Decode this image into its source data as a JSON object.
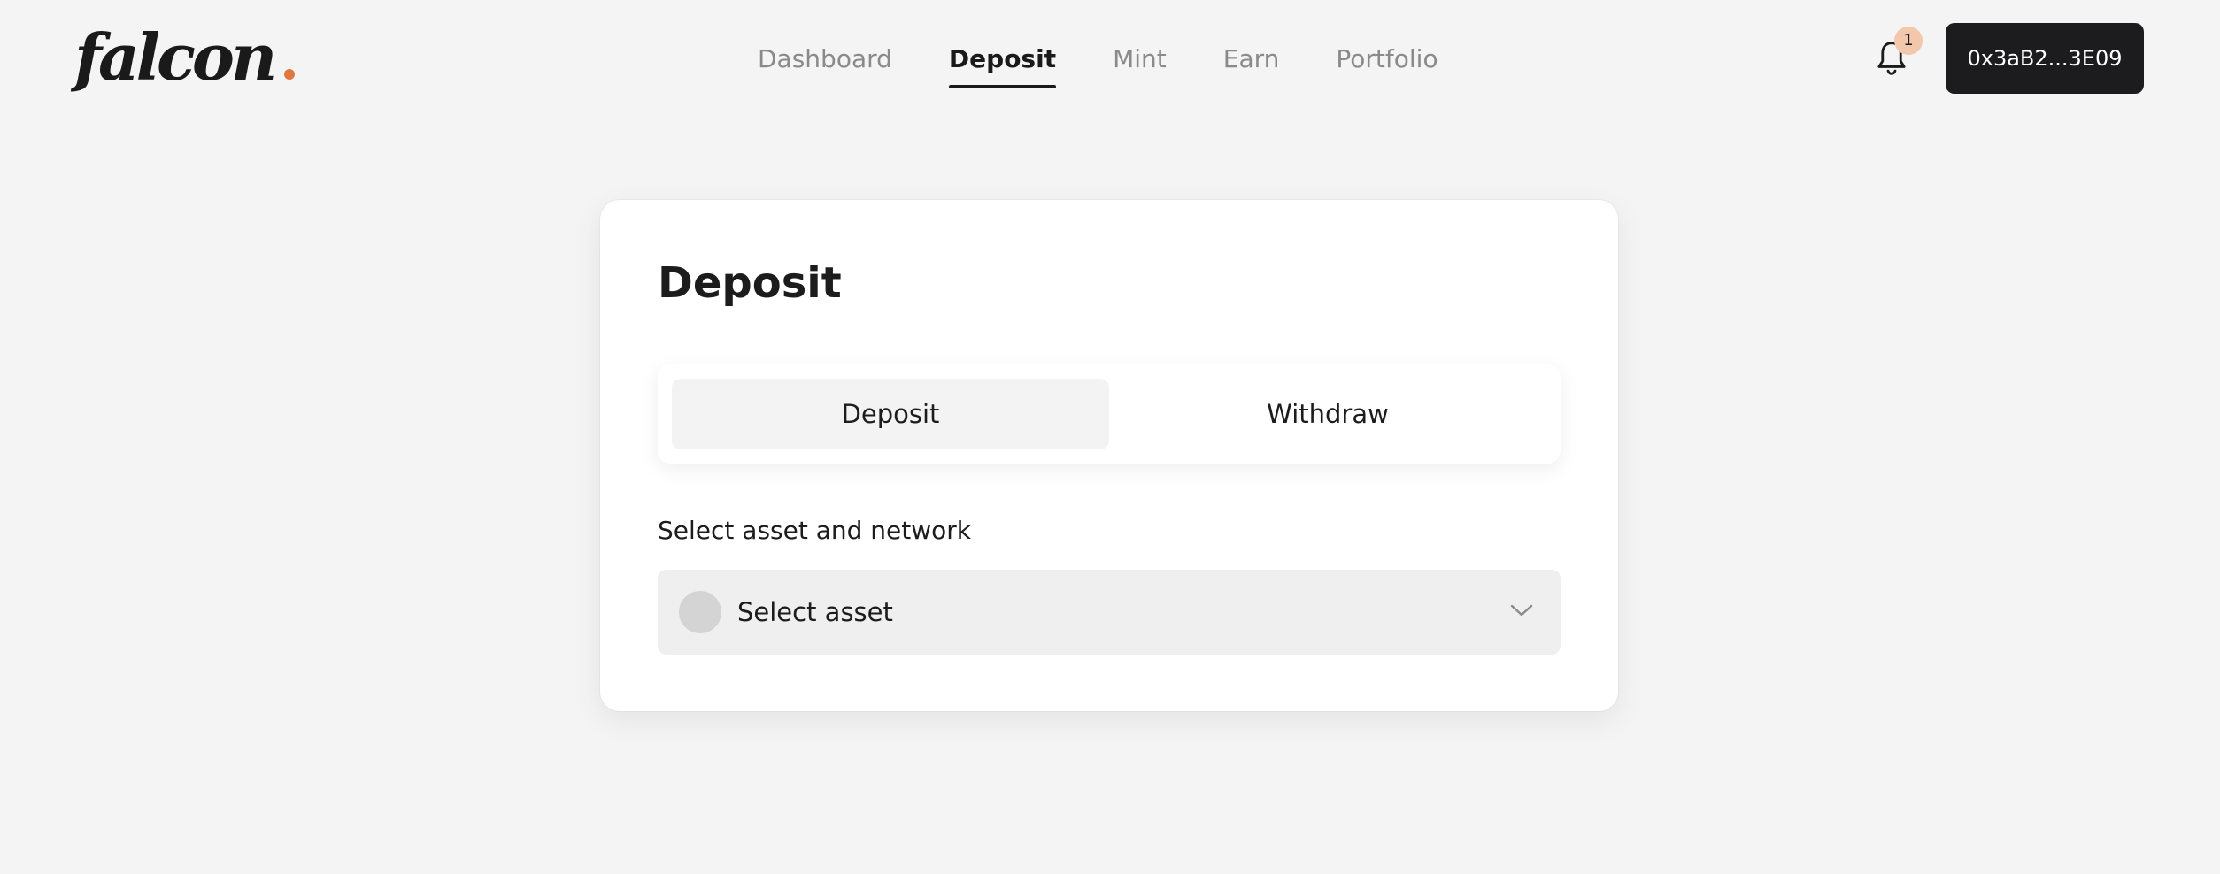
{
  "brand": {
    "logo_text": "falcon",
    "accent_color": "#e0773f"
  },
  "nav": {
    "items": [
      {
        "label": "Dashboard",
        "active": false
      },
      {
        "label": "Deposit",
        "active": true
      },
      {
        "label": "Mint",
        "active": false
      },
      {
        "label": "Earn",
        "active": false
      },
      {
        "label": "Portfolio",
        "active": false
      }
    ]
  },
  "notifications": {
    "icon": "bell-icon",
    "count": "1",
    "badge_color": "#f2c7ac"
  },
  "wallet": {
    "address_label": "0x3aB2...3E09"
  },
  "card": {
    "title": "Deposit",
    "tabs": [
      {
        "label": "Deposit",
        "active": true
      },
      {
        "label": "Withdraw",
        "active": false
      }
    ],
    "asset_field": {
      "label": "Select asset and network",
      "placeholder": "Select asset",
      "icon": "chevron-down-icon"
    }
  }
}
